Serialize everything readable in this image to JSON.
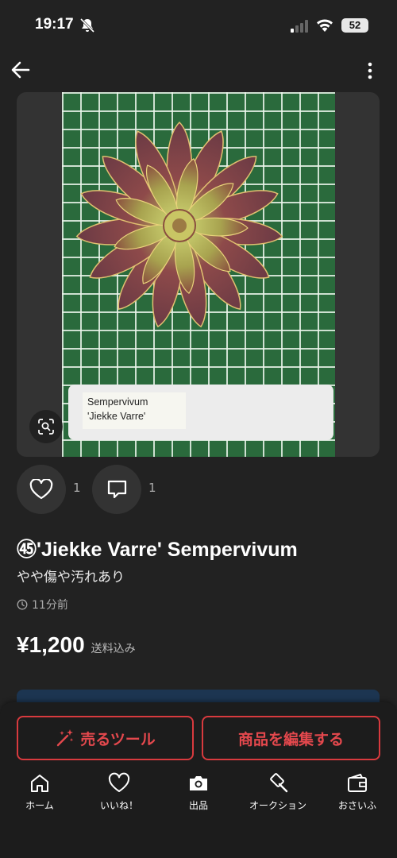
{
  "status_bar": {
    "time": "19:17",
    "battery": "52"
  },
  "product": {
    "photo_label_line1": "Sempervivum",
    "photo_label_line2": "'Jiekke Varre'",
    "like_count": "1",
    "comment_count": "1",
    "title": "㊺'Jiekke Varre' Sempervivum",
    "condition": "やや傷や汚れあり",
    "posted_time": "11分前",
    "price": "¥1,200",
    "shipping": "送料込み"
  },
  "actions": {
    "sell_tools_label": "売るツール",
    "edit_item_label": "商品を編集する"
  },
  "tab_bar": {
    "home": "ホーム",
    "likes": "いいね！",
    "listing": "出品",
    "auction": "オークション",
    "wallet": "おさいふ"
  },
  "colors": {
    "background": "#222222",
    "accent_red": "#e4484d",
    "banner_blue": "#1c3551",
    "grid_green": "#2a6a3c"
  },
  "icons": [
    "bell-off-icon",
    "signal-icon",
    "wifi-icon",
    "battery-icon",
    "back-arrow-icon",
    "more-vertical-icon",
    "lens-search-icon",
    "heart-icon",
    "comment-icon",
    "clock-icon",
    "magic-wand-icon",
    "home-icon",
    "camera-icon",
    "gavel-icon",
    "wallet-icon"
  ]
}
